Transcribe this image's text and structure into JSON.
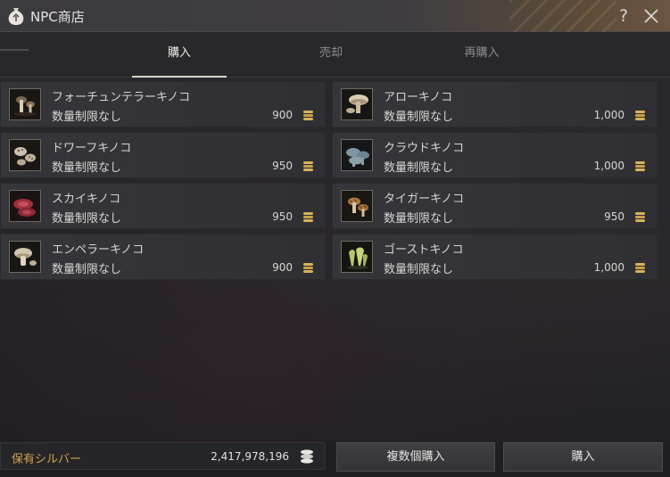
{
  "window": {
    "title": "NPC商店",
    "help_label": "?",
    "icons": {
      "title": "money-bag-icon",
      "close": "close-icon"
    }
  },
  "tabs": [
    {
      "label": "購入",
      "active": true
    },
    {
      "label": "売却",
      "active": false
    },
    {
      "label": "再購入",
      "active": false
    }
  ],
  "items": [
    {
      "name": "フォーチュンテラーキノコ",
      "limit": "数量制限なし",
      "price": "900",
      "icon": "fortune-teller-mushroom-icon"
    },
    {
      "name": "アローキノコ",
      "limit": "数量制限なし",
      "price": "1,000",
      "icon": "arrow-mushroom-icon"
    },
    {
      "name": "ドワーフキノコ",
      "limit": "数量制限なし",
      "price": "950",
      "icon": "dwarf-mushroom-icon"
    },
    {
      "name": "クラウドキノコ",
      "limit": "数量制限なし",
      "price": "1,000",
      "icon": "cloud-mushroom-icon"
    },
    {
      "name": "スカイキノコ",
      "limit": "数量制限なし",
      "price": "950",
      "icon": "sky-mushroom-icon"
    },
    {
      "name": "タイガーキノコ",
      "limit": "数量制限なし",
      "price": "950",
      "icon": "tiger-mushroom-icon"
    },
    {
      "name": "エンペラーキノコ",
      "limit": "数量制限なし",
      "price": "900",
      "icon": "emperor-mushroom-icon"
    },
    {
      "name": "ゴーストキノコ",
      "limit": "数量制限なし",
      "price": "1,000",
      "icon": "ghost-mushroom-icon"
    }
  ],
  "footer": {
    "silver_label": "保有シルバー",
    "silver_amount": "2,417,978,196",
    "multi_buy_label": "複数個購入",
    "buy_label": "購入"
  },
  "colors": {
    "accent_gold": "#d5a24c",
    "coin": "#d9b25a",
    "text": "#d7d6d4",
    "inactive_tab": "#8c8b8d"
  }
}
